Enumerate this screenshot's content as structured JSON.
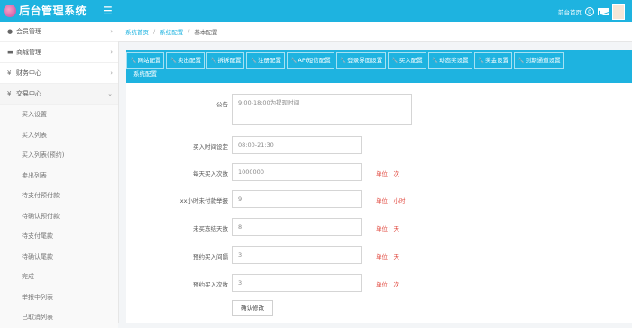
{
  "app": {
    "title": "后台管理系统",
    "menu_icon": "hamburger-icon"
  },
  "topbar": {
    "home_label": "前台首页",
    "msg_count": "0"
  },
  "sidebar": {
    "items": [
      {
        "icon": "user-icon",
        "label": "会员管理"
      },
      {
        "icon": "cart-icon",
        "label": "商城管理"
      },
      {
        "icon": "yen-icon",
        "label": "财务中心"
      },
      {
        "icon": "yen-icon",
        "label": "交易中心"
      }
    ],
    "sub_items": [
      "买入设置",
      "买入列表",
      "买入列表(预约)",
      "卖出列表",
      "待支付预付款",
      "待确认预付款",
      "待支付尾款",
      "待确认尾款",
      "完成",
      "举报中列表",
      "已取消列表"
    ]
  },
  "breadcrumb": {
    "home": "系统首页",
    "system": "系统配置",
    "current": "基本配置"
  },
  "tabs": [
    "网站配置",
    "卖出配置",
    "拆拆配置",
    "注册配置",
    "API短信配置",
    "登录界面设置",
    "买入配置",
    "动态奖设置",
    "奖金设置",
    "到期通道设置"
  ],
  "tab_second": "系统配置",
  "form": {
    "notice_label": "公告",
    "notice_value": "9:00-18:00为提现时间",
    "fields": [
      {
        "label": "买入时间设定",
        "value": "08:00-21:30",
        "unit": ""
      },
      {
        "label": "每天买入次数",
        "value": "1000000",
        "unit": "单位：次"
      },
      {
        "label": "xx小时未付款举报",
        "value": "9",
        "unit": "单位：小时"
      },
      {
        "label": "未买冻结天数",
        "value": "8",
        "unit": "单位：天"
      },
      {
        "label": "预约买入间隔",
        "value": "3",
        "unit": "单位：天"
      },
      {
        "label": "预约买入次数",
        "value": "3",
        "unit": "单位：次"
      }
    ],
    "submit_label": "确认修改"
  }
}
